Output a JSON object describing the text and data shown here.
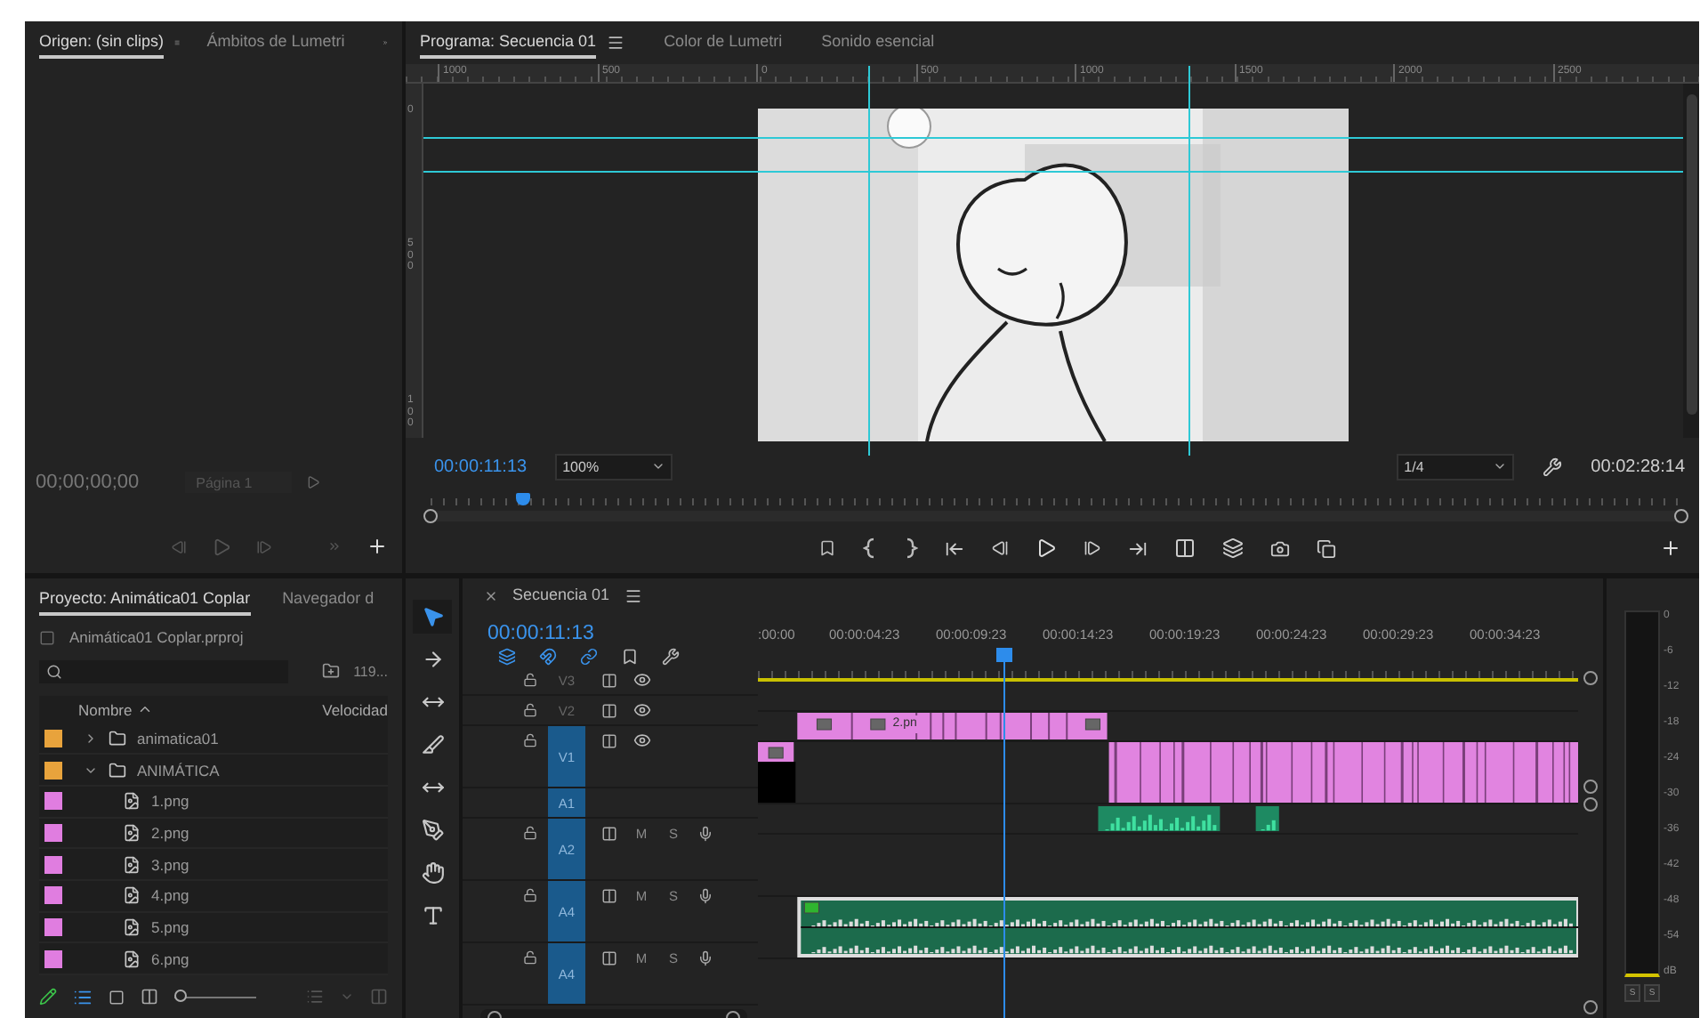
{
  "source_panel": {
    "tabs": [
      {
        "label": "Origen: (sin clips)",
        "selected": true
      },
      {
        "label": "Ámbitos de Lumetri",
        "selected": false
      }
    ],
    "timecode": "00;00;00;00",
    "page_field": "Página 1"
  },
  "program_panel": {
    "tabs": [
      {
        "label": "Programa: Secuencia 01",
        "selected": true
      },
      {
        "label": "Color de Lumetri",
        "selected": false
      },
      {
        "label": "Sonido esencial",
        "selected": false
      }
    ],
    "ruler_labels": [
      "1000",
      "500",
      "0",
      "500",
      "1000",
      "1500",
      "2000",
      "2500"
    ],
    "vertical_ruler_labels": [
      "0",
      "500",
      "100"
    ],
    "timecode": "00:00:11:13",
    "zoom": "100%",
    "resolution": "1/4",
    "duration": "00:02:28:14",
    "playhead": {
      "level": 0.074
    }
  },
  "project_panel": {
    "tabs": [
      {
        "label": "Proyecto: Animática01 Coplar",
        "selected": true
      },
      {
        "label": "Navegador d",
        "selected": false
      }
    ],
    "file": "Animática01 Coplar.prproj",
    "zoom_slider": {
      "level": 0
    },
    "count": "119...",
    "columns": [
      "Nombre",
      "Velocidad"
    ],
    "items": [
      {
        "name": "animatica01",
        "kind": "folder",
        "color": "#e8a33c",
        "expanded": false
      },
      {
        "name": "ANIMÁTICA",
        "kind": "folder",
        "color": "#e8a33c",
        "expanded": true,
        "children": [
          {
            "name": "1.png",
            "kind": "image",
            "color": "#e07de0"
          },
          {
            "name": "2.png",
            "kind": "image",
            "color": "#e07de0"
          },
          {
            "name": "3.png",
            "kind": "image",
            "color": "#e07de0"
          },
          {
            "name": "4.png",
            "kind": "image",
            "color": "#e07de0"
          },
          {
            "name": "5.png",
            "kind": "image",
            "color": "#e07de0"
          },
          {
            "name": "6.png",
            "kind": "image",
            "color": "#e07de0"
          }
        ]
      }
    ]
  },
  "tools": [
    {
      "kind": "selection",
      "selected": true
    },
    {
      "kind": "track-select",
      "selected": false
    },
    {
      "kind": "ripple",
      "selected": false
    },
    {
      "kind": "razor",
      "selected": false
    },
    {
      "kind": "slip",
      "selected": false
    },
    {
      "kind": "pen",
      "selected": false
    },
    {
      "kind": "hand",
      "selected": false
    },
    {
      "kind": "type",
      "selected": false
    }
  ],
  "timeline": {
    "title": "Secuencia 01",
    "timecode": "00:00:11:13",
    "toggles": [
      {
        "kind": "nest",
        "on": true
      },
      {
        "kind": "snap",
        "on": true
      },
      {
        "kind": "linked",
        "on": true
      },
      {
        "kind": "marker",
        "on": false
      },
      {
        "kind": "settings",
        "on": false
      }
    ],
    "time_labels": [
      ":00:00",
      "00:00:04:23",
      "00:00:09:23",
      "00:00:14:23",
      "00:00:19:23",
      "00:00:24:23",
      "00:00:29:23",
      "00:00:34:23"
    ],
    "playhead": {
      "level": 0.3
    },
    "tracks": [
      {
        "label": "V3",
        "kind": "video",
        "targeted": false,
        "expanded": false
      },
      {
        "label": "V2",
        "kind": "video",
        "targeted": false,
        "expanded": false,
        "clip_label": "2.pn"
      },
      {
        "label": "V1",
        "kind": "video",
        "targeted": true,
        "expanded": true
      },
      {
        "label": "A1",
        "kind": "audio",
        "targeted": true,
        "expanded": false
      },
      {
        "label": "A2",
        "kind": "audio",
        "targeted": true,
        "expanded": true,
        "buttons": [
          "M",
          "S"
        ]
      },
      {
        "label": "A4",
        "kind": "audio",
        "targeted": true,
        "expanded": true,
        "buttons": [
          "M",
          "S"
        ]
      },
      {
        "label": "A4",
        "kind": "audio",
        "targeted": true,
        "expanded": true,
        "buttons": [
          "M",
          "S"
        ]
      }
    ]
  },
  "audio_meter": {
    "labels": [
      "0",
      "-6",
      "-12",
      "-18",
      "-24",
      "-30",
      "-36",
      "-42",
      "-48",
      "-54",
      "dB"
    ],
    "solo_buttons": [
      "S",
      "S"
    ]
  }
}
